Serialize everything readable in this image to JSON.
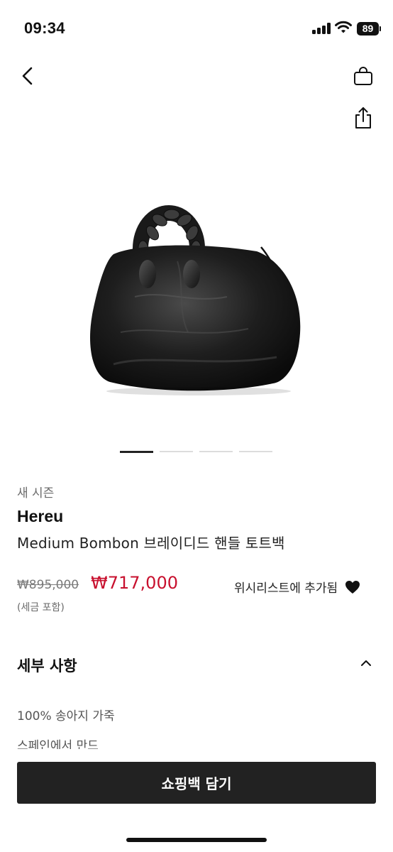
{
  "status_bar": {
    "time": "09:34",
    "battery": "89",
    "icons": [
      "signal-icon",
      "wifi-icon",
      "battery-icon"
    ]
  },
  "nav": {
    "icons": [
      "back-chevron-icon",
      "shopping-bag-icon",
      "share-icon"
    ]
  },
  "gallery": {
    "image_description": "black-leather-bag-with-braided-handle",
    "page_count": 4,
    "current_page": 1
  },
  "product": {
    "season_label": "새 시즌",
    "brand": "Hereu",
    "name": "Medium Bombon 브레이디드 핸들 토트백",
    "original_price": "₩895,000",
    "sale_price": "₩717,000",
    "tax_note": "(세금 포함)",
    "wishlist_label": "위시리스트에 추가됨"
  },
  "details": {
    "title": "세부 사항",
    "lines": [
      "100% 송아지 가죽",
      "스페인에서 만드"
    ]
  },
  "cta": {
    "add_to_bag": "쇼핑백 담기"
  },
  "colors": {
    "sale_price": "#c8102e",
    "cta_background": "#222222",
    "text_primary": "#111111"
  }
}
